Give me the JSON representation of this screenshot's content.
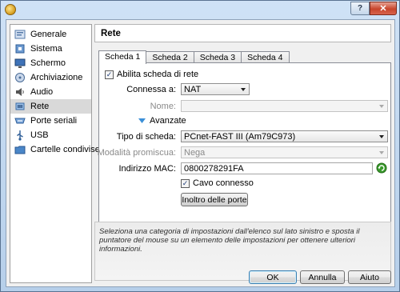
{
  "window": {
    "help_glyph": "?",
    "close_glyph": "✕"
  },
  "sidebar": {
    "items": [
      {
        "label": "Generale",
        "icon": "general-icon"
      },
      {
        "label": "Sistema",
        "icon": "system-chip-icon"
      },
      {
        "label": "Schermo",
        "icon": "display-monitor-icon"
      },
      {
        "label": "Archiviazione",
        "icon": "storage-disk-icon"
      },
      {
        "label": "Audio",
        "icon": "speaker-icon"
      },
      {
        "label": "Rete",
        "icon": "network-icon",
        "selected": true
      },
      {
        "label": "Porte seriali",
        "icon": "serial-port-icon"
      },
      {
        "label": "USB",
        "icon": "usb-icon"
      },
      {
        "label": "Cartelle condivise",
        "icon": "shared-folder-icon"
      }
    ]
  },
  "page": {
    "title": "Rete"
  },
  "tabs": [
    {
      "label": "Scheda 1",
      "active": true
    },
    {
      "label": "Scheda 2"
    },
    {
      "label": "Scheda 3"
    },
    {
      "label": "Scheda 4"
    }
  ],
  "form": {
    "enable_label": "Abilita scheda di rete",
    "enable_checked": true,
    "attached_label": "Connessa a:",
    "attached_value": "NAT",
    "name_label": "Nome:",
    "name_value": "",
    "advanced_label": "Avanzate",
    "adapter_label": "Tipo di scheda:",
    "adapter_value": "PCnet-FAST III (Am79C973)",
    "promisc_label": "Modalità promiscua:",
    "promisc_value": "Nega",
    "mac_label": "Indirizzo MAC:",
    "mac_value": "0800278291FA",
    "cable_label": "Cavo connesso",
    "cable_checked": true,
    "port_forward_label": "Inoltro delle porte"
  },
  "info": {
    "text": "Seleziona una categoria di impostazioni dall'elenco sul lato sinistro e sposta il puntatore del mouse su un elemento delle impostazioni per ottenere ulteriori informazioni."
  },
  "buttons": {
    "ok": "OK",
    "cancel": "Annulla",
    "help": "Aiuto"
  },
  "colors": {
    "accent": "#3c7fb1",
    "selected_bg": "#d9d9d9",
    "refresh_green": "#3a9a2c"
  }
}
